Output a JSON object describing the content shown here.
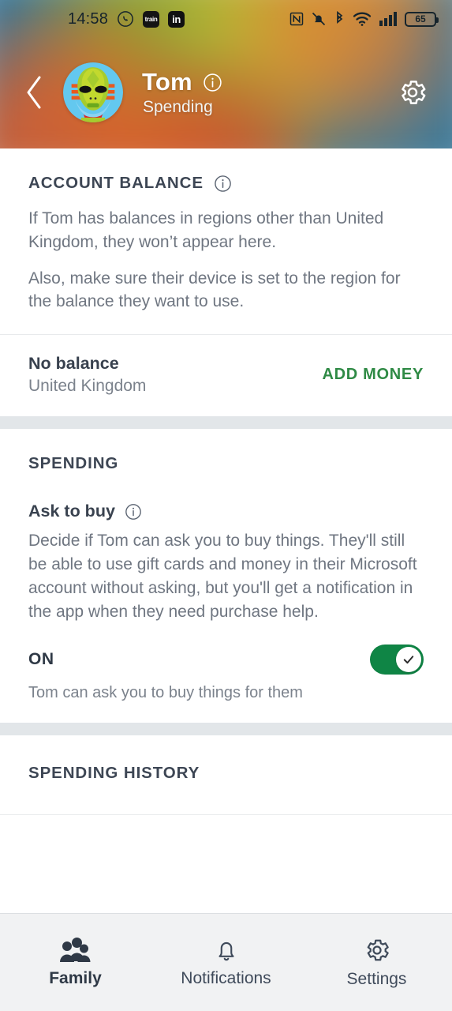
{
  "statusbar": {
    "time": "14:58",
    "apps": [
      {
        "name": "whatsapp-icon",
        "label": ""
      },
      {
        "name": "train-app-icon",
        "label": "train"
      },
      {
        "name": "linkedin-icon",
        "label": "in"
      }
    ],
    "indicators": [
      "nfc-icon",
      "mute-bell-icon",
      "bluetooth-icon",
      "wifi-icon",
      "cellular-signal-icon"
    ],
    "battery_percent": "65"
  },
  "header": {
    "back_label": "Back",
    "name": "Tom",
    "subtitle": "Spending",
    "info_label": "i",
    "settings_label": "Settings"
  },
  "account_balance": {
    "section_title": "ACCOUNT BALANCE",
    "info_label": "i",
    "paragraph1": "If Tom has balances in regions other than United Kingdom, they won’t appear here.",
    "paragraph2": "Also, make sure their device is set to the region for the balance they want to use.",
    "balance_main": "No balance",
    "balance_region": "United Kingdom",
    "add_money_label": "ADD MONEY"
  },
  "spending": {
    "section_title": "SPENDING",
    "ask_to_buy_title": "Ask to buy",
    "info_label": "i",
    "description": "Decide if Tom can ask you to buy things. They'll still be able to use gift cards and money in their Microsoft account without asking, but you'll get a notification in the app when they need purchase help.",
    "toggle_state": "ON",
    "toggle_caption": "Tom can ask you to buy things for them"
  },
  "spending_history": {
    "section_title": "SPENDING HISTORY"
  },
  "bottom_nav": {
    "items": [
      {
        "label": "Family",
        "icon": "family-icon",
        "active": true
      },
      {
        "label": "Notifications",
        "icon": "bell-icon",
        "active": false
      },
      {
        "label": "Settings",
        "icon": "gear-icon",
        "active": false
      }
    ]
  },
  "colors": {
    "accent_green": "#2f8a45",
    "toggle_green": "#0f8545",
    "heading": "#3d4654",
    "body": "#6f7681",
    "band": "#e2e6e9",
    "nav_bg": "#f1f2f3"
  }
}
